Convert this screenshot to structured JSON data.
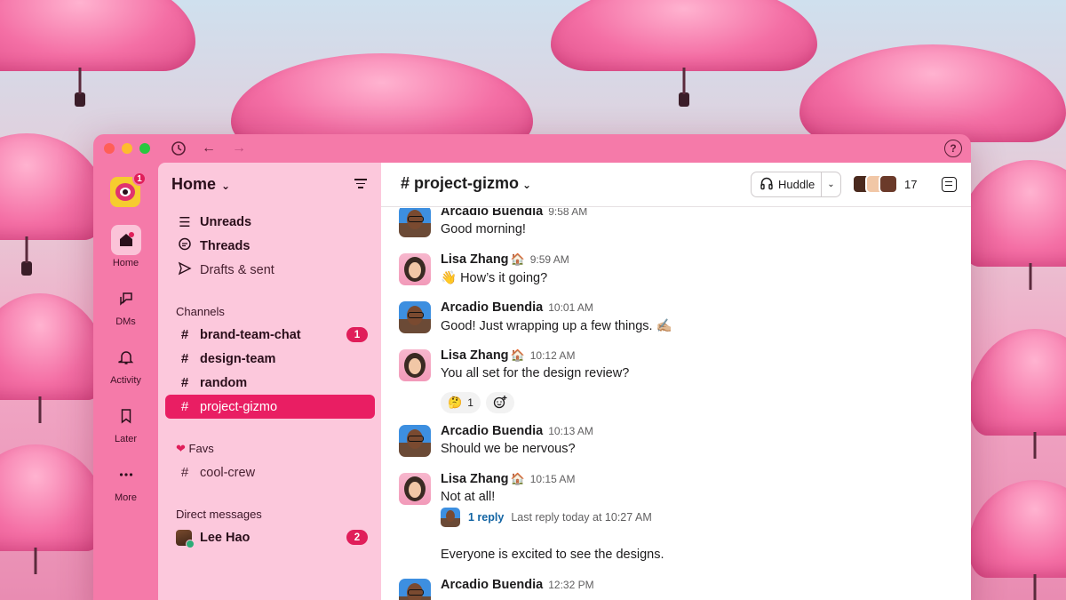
{
  "titlebar": {
    "history_icon": "clock-icon",
    "back_icon": "arrow-left-icon",
    "forward_icon": "arrow-right-icon",
    "help_label": "?"
  },
  "rail": {
    "workspace_badge": "1",
    "items": [
      {
        "label": "Home",
        "icon": "home-icon"
      },
      {
        "label": "DMs",
        "icon": "dms-icon"
      },
      {
        "label": "Activity",
        "icon": "bell-icon"
      },
      {
        "label": "Later",
        "icon": "bookmark-icon"
      },
      {
        "label": "More",
        "icon": "more-icon"
      }
    ]
  },
  "sidebar": {
    "title": "Home",
    "nav": [
      {
        "label": "Unreads"
      },
      {
        "label": "Threads"
      },
      {
        "label": "Drafts & sent"
      }
    ],
    "channels_header": "Channels",
    "channels": [
      {
        "name": "brand-team-chat",
        "badge": "1"
      },
      {
        "name": "design-team"
      },
      {
        "name": "random"
      },
      {
        "name": "project-gizmo"
      }
    ],
    "favs_header": "Favs",
    "favs": [
      {
        "name": "cool-crew"
      }
    ],
    "dm_header": "Direct messages",
    "dms": [
      {
        "name": "Lee Hao",
        "badge": "2"
      }
    ]
  },
  "channel": {
    "name": "# project-gizmo",
    "huddle_label": "Huddle",
    "member_count": "17"
  },
  "messages": [
    {
      "author": "Arcadio Buendia",
      "emoji": "",
      "time": "9:58 AM",
      "text": "Good morning!"
    },
    {
      "author": "Lisa Zhang",
      "emoji": "🏠",
      "time": "9:59 AM",
      "text": "👋 How’s it going?"
    },
    {
      "author": "Arcadio Buendia",
      "emoji": "",
      "time": "10:01 AM",
      "text": "Good! Just wrapping up a few things. ✍🏼"
    },
    {
      "author": "Lisa Zhang",
      "emoji": "🏠",
      "time": "10:12 AM",
      "text": "You all set for the design review?"
    },
    {
      "author": "Arcadio Buendia",
      "emoji": "",
      "time": "10:13 AM",
      "text": "Should we be nervous?"
    },
    {
      "author": "Lisa Zhang",
      "emoji": "🏠",
      "time": "10:15 AM",
      "text": "Not at all!"
    },
    {
      "author": "Arcadio Buendia",
      "emoji": "",
      "time": "12:32 PM",
      "text": ""
    }
  ],
  "reaction": {
    "emoji": "🤔",
    "count": "1"
  },
  "thread": {
    "replies": "1 reply",
    "last_reply": "Last reply today at 10:27 AM"
  },
  "continuation": "Everyone is excited to see the designs.",
  "colors": {
    "accent": "#e91e63",
    "sidebar": "#fcc8dc",
    "window": "#f57aa9",
    "link": "#1264a3"
  }
}
